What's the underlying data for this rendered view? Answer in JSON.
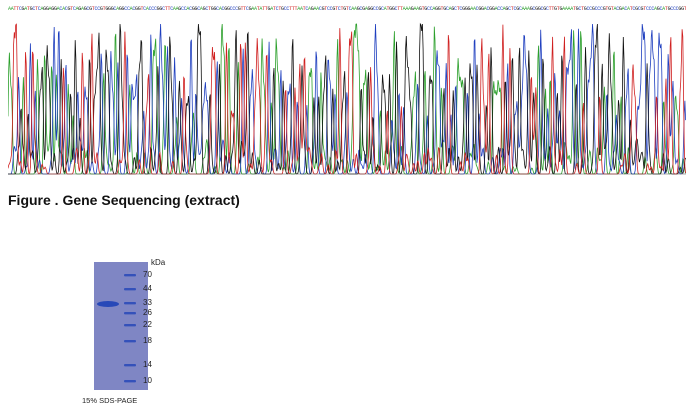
{
  "sequence": {
    "bases": "AATTCGATGCTCAGGAGGACACGTCAGAGCGTCCGTGGGCAGGCCACGGTCACCCGGCTTCAAGCCACGGCAGCTGGCACGGCCCGTTCGAATATTGATCTGCCTTTAATCAGAACGTCCGTCTGTCAAGCGAGGCCGCATGGCTTAAAGAAGTGCCAGGTGCAGCTCGGGAACGGACGGACCAGCTCGCAAAGCGGCGCTTGTGAAAATGCTGCCGCCCGTGTACGACATCGCGTCCCAGCATGCCCGGTGACGGACGAGCCGTTCCCCGCCCTCCATCTCAATTC",
    "base_colors": {
      "A": "#2ca02c",
      "C": "#1f3fbf",
      "G": "#111111",
      "T": "#d02020"
    }
  },
  "figure": {
    "caption": "Figure . Gene Sequencing (extract)"
  },
  "gel": {
    "unit_label": "kDa",
    "ladder_kda": [
      "70",
      "44",
      "33",
      "26",
      "22",
      "18",
      "14",
      "10"
    ],
    "sample_band_kda": "33",
    "caption": "15% SDS-PAGE",
    "gel_color": "#7f86c4",
    "band_color": "#2748b8"
  }
}
